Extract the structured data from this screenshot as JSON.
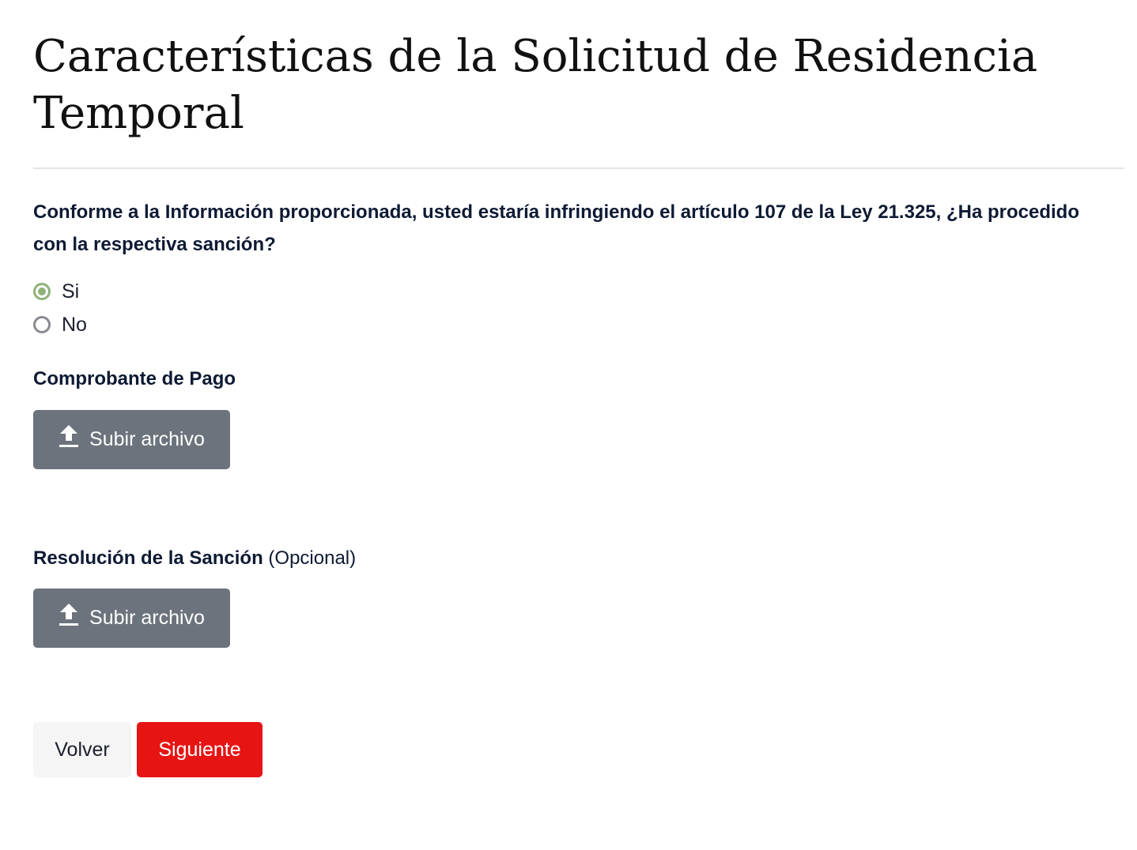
{
  "header": {
    "title": "Características de la Solicitud de Residencia Temporal"
  },
  "form": {
    "question": "Conforme a la Información proporcionada, usted estaría infringiendo el artículo 107 de la Ley 21.325, ¿Ha procedido con la respectiva sanción?",
    "options": [
      {
        "label": "Si",
        "checked": true
      },
      {
        "label": "No",
        "checked": false
      }
    ],
    "comprobante": {
      "label": "Comprobante de Pago",
      "button_label": "Subir archivo"
    },
    "resolucion": {
      "label": "Resolución de la Sanción",
      "optional_label": "(Opcional)",
      "button_label": "Subir archivo"
    }
  },
  "actions": {
    "back_label": "Volver",
    "next_label": "Siguiente"
  },
  "colors": {
    "accent_red": "#e71414",
    "upload_gray": "#6c737c",
    "radio_checked": "#8fb27a"
  },
  "icons": {
    "upload": "upload-icon"
  }
}
